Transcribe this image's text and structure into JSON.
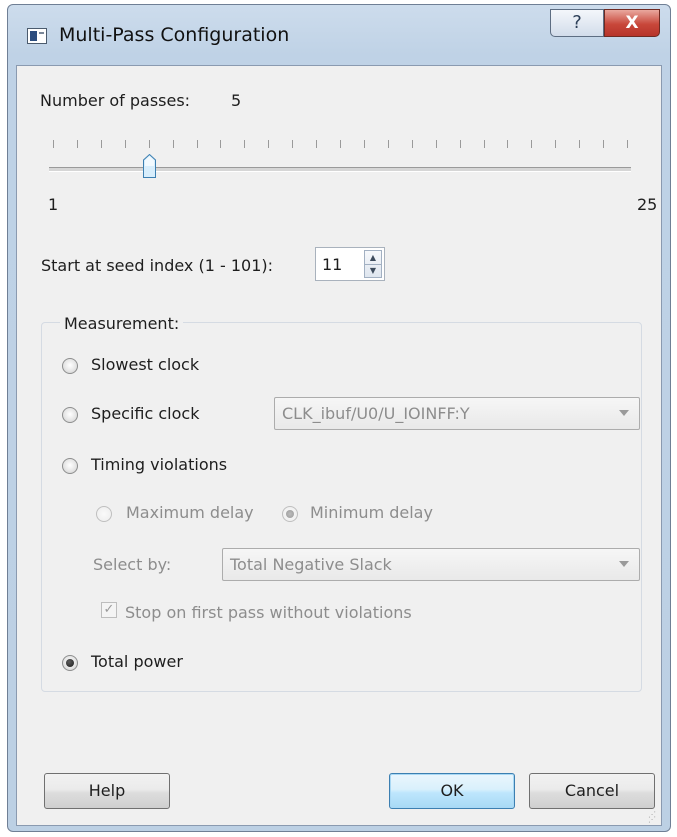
{
  "window": {
    "title": "Multi-Pass Configuration",
    "help_glyph": "?",
    "close_glyph": "X"
  },
  "passes": {
    "label": "Number of passes:",
    "value": "5",
    "slider_min_label": "1",
    "slider_max_label": "25",
    "slider_min": 1,
    "slider_max": 25,
    "slider_value": 5
  },
  "seed": {
    "label": "Start at seed index (1 - 101):",
    "value": "11"
  },
  "measurement": {
    "title": "Measurement:",
    "slowest_clock": {
      "label": "Slowest clock",
      "selected": false
    },
    "specific_clock": {
      "label": "Specific clock",
      "selected": false,
      "combo_value": "CLK_ibuf/U0/U_IOINFF:Y"
    },
    "timing_violations": {
      "label": "Timing violations",
      "selected": false
    },
    "maximum_delay": {
      "label": "Maximum delay",
      "selected": false,
      "enabled": false
    },
    "minimum_delay": {
      "label": "Minimum delay",
      "selected": true,
      "enabled": false
    },
    "select_by": {
      "label": "Select by:",
      "combo_value": "Total Negative Slack",
      "enabled": false
    },
    "stop_on_first": {
      "label": "Stop on first pass without violations",
      "checked": true,
      "enabled": false
    },
    "total_power": {
      "label": "Total power",
      "selected": true
    }
  },
  "buttons": {
    "help": "Help",
    "ok": "OK",
    "cancel": "Cancel"
  },
  "icons": {
    "app": "dialog-window-icon",
    "help": "question-mark-icon",
    "close": "close-icon",
    "spin_up": "up-arrow-icon",
    "spin_down": "down-arrow-icon",
    "combo": "chevron-down-icon"
  },
  "colors": {
    "frame": "#bcd0e4",
    "client": "#f0f0f0",
    "close_button": "#c8473a",
    "ok_button": "#bee6fd",
    "disabled_text": "#8d8d8d"
  }
}
